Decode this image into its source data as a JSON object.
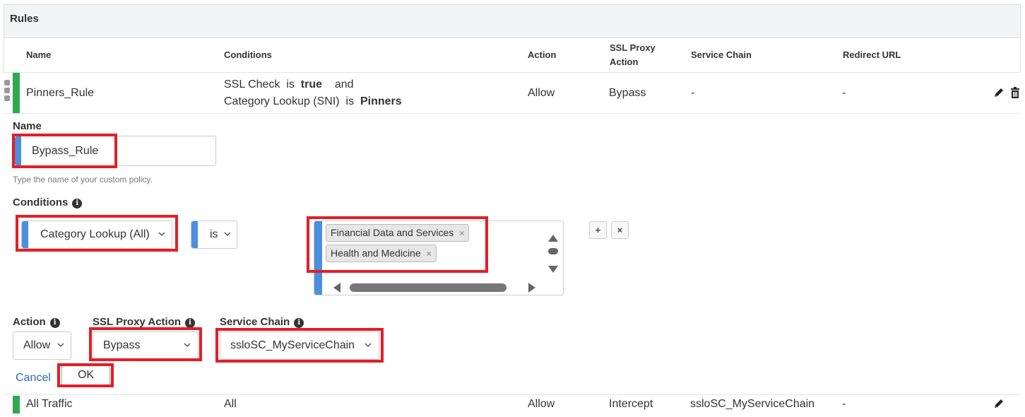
{
  "panel": {
    "title": "Rules"
  },
  "columns": {
    "name": "Name",
    "conditions": "Conditions",
    "action": "Action",
    "ssl_proxy_action_line1": "SSL Proxy",
    "ssl_proxy_action_line2": "Action",
    "service_chain": "Service Chain",
    "redirect_url": "Redirect URL"
  },
  "rows": [
    {
      "name": "Pinners_Rule",
      "cond1_key": "SSL Check",
      "cond1_op": "is",
      "cond1_val": "true",
      "cond1_join": "and",
      "cond2_key": "Category Lookup (SNI)",
      "cond2_op": "is",
      "cond2_val": "Pinners",
      "action": "Allow",
      "ssl_proxy_action": "Bypass",
      "service_chain": "-",
      "redirect_url": "-"
    },
    {
      "name": "All Traffic",
      "conditions": "All",
      "action": "Allow",
      "ssl_proxy_action": "Intercept",
      "service_chain": "ssloSC_MyServiceChain",
      "redirect_url": "-"
    }
  ],
  "form": {
    "name_label": "Name",
    "name_value": "Bypass_Rule",
    "name_help": "Type the name of your custom policy.",
    "conditions_label": "Conditions",
    "condition_type": "Category Lookup (All)",
    "condition_operator": "is",
    "condition_values": [
      "Financial Data and Services",
      "Health and Medicine"
    ],
    "action_label": "Action",
    "action_value": "Allow",
    "ssl_proxy_action_label": "SSL Proxy Action",
    "ssl_proxy_action_value": "Bypass",
    "service_chain_label": "Service Chain",
    "service_chain_value": "ssloSC_MyServiceChain",
    "cancel_label": "Cancel",
    "ok_label": "OK",
    "add_symbol": "+",
    "remove_symbol": "×",
    "tag_remove_symbol": "×"
  },
  "colors": {
    "accent_blue": "#4a8fe0",
    "rule_green": "#2fa84f",
    "highlight_red": "#e41e26",
    "link_blue": "#2a6ebb"
  }
}
